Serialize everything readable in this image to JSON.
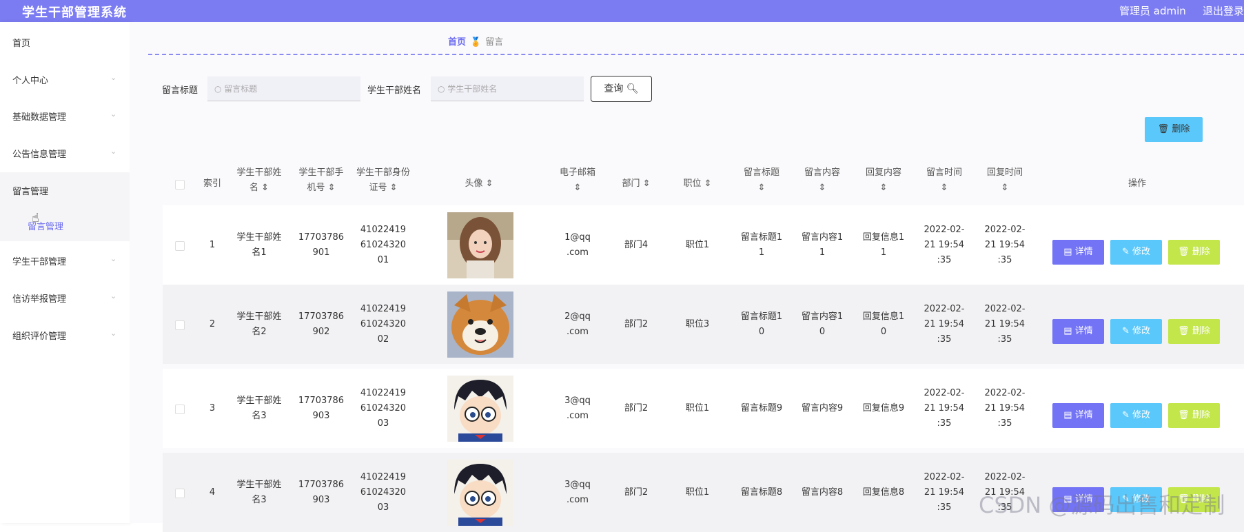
{
  "header": {
    "title": "学生干部管理系统",
    "user": "管理员 admin",
    "logout": "退出登录"
  },
  "sidebar": {
    "items": [
      "首页",
      "个人中心",
      "基础数据管理",
      "公告信息管理",
      "留言管理",
      "学生干部管理",
      "信访举报管理",
      "组织评价管理"
    ],
    "sub_item": "留言管理"
  },
  "breadcrumb": {
    "home": "首页",
    "current": "留言"
  },
  "search": {
    "title_label": "留言标题",
    "title_placeholder": "留言标题",
    "name_label": "学生干部姓名",
    "name_placeholder": "学生干部姓名",
    "query": "查询"
  },
  "toolbar": {
    "delete": "删除"
  },
  "table": {
    "headers": [
      "索引",
      "学生干部姓名",
      "学生干部手机号",
      "学生干部身份证号",
      "头像",
      "电子邮箱",
      "部门",
      "职位",
      "留言标题",
      "留言内容",
      "回复内容",
      "留言时间",
      "回复时间",
      "操作"
    ],
    "rows": [
      {
        "index": "1",
        "name": "学生干部姓名1",
        "phone": "17703786901",
        "idcard": "410224196102432001",
        "avatar": "girl",
        "email": "1@qq.com",
        "dept": "部门4",
        "pos": "职位1",
        "title": "留言标题11",
        "content": "留言内容11",
        "reply": "回复信息11",
        "time1": "2022-02-21 19:54:35",
        "time2": "2022-02-21 19:54:35"
      },
      {
        "index": "2",
        "name": "学生干部姓名2",
        "phone": "17703786902",
        "idcard": "410224196102432002",
        "avatar": "dog",
        "email": "2@qq.com",
        "dept": "部门2",
        "pos": "职位3",
        "title": "留言标题10",
        "content": "留言内容10",
        "reply": "回复信息10",
        "time1": "2022-02-21 19:54:35",
        "time2": "2022-02-21 19:54:35"
      },
      {
        "index": "3",
        "name": "学生干部姓名3",
        "phone": "17703786903",
        "idcard": "410224196102432003",
        "avatar": "conan",
        "email": "3@qq.com",
        "dept": "部门2",
        "pos": "职位1",
        "title": "留言标题9",
        "content": "留言内容9",
        "reply": "回复信息9",
        "time1": "2022-02-21 19:54:35",
        "time2": "2022-02-21 19:54:35"
      },
      {
        "index": "4",
        "name": "学生干部姓名3",
        "phone": "17703786903",
        "idcard": "410224196102432003",
        "avatar": "conan",
        "email": "3@qq.com",
        "dept": "部门2",
        "pos": "职位1",
        "title": "留言标题8",
        "content": "留言内容8",
        "reply": "回复信息8",
        "time1": "2022-02-21 19:54:35",
        "time2": "2022-02-21 19:54:35"
      }
    ],
    "actions": {
      "detail": "详情",
      "edit": "修改",
      "delete": "删除"
    }
  },
  "watermark": "CSDN @源码出售和定制"
}
